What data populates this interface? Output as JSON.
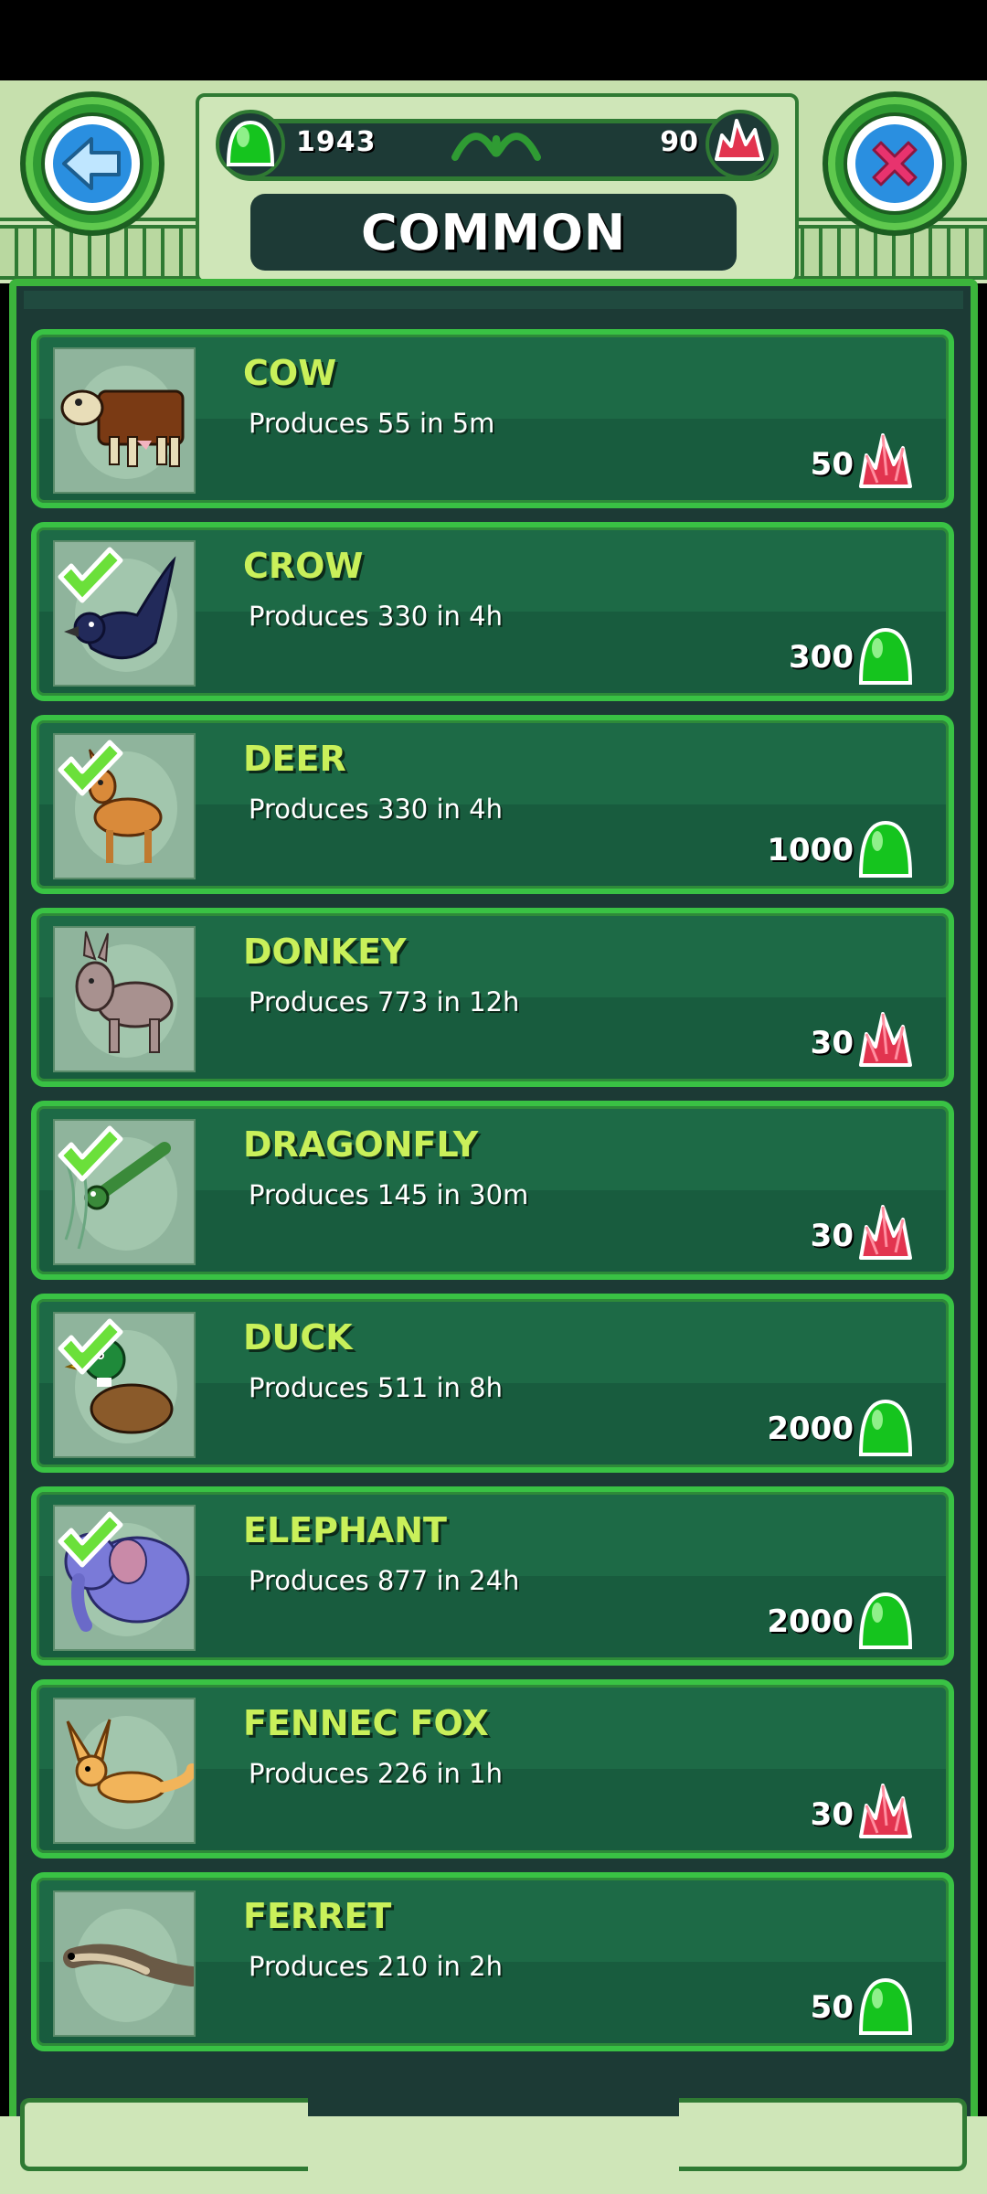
{
  "header": {
    "gem_count": "1943",
    "ruby_count": "90",
    "title": "COMMON",
    "back_icon": "back-arrow-icon",
    "close_icon": "close-x-icon"
  },
  "colors": {
    "row_border": "#39c244",
    "name_text": "#c9f05a",
    "panel_bg": "#1c3a35"
  },
  "animals": [
    {
      "name": "COW",
      "desc": "Produces 55 in 5m",
      "price": "50",
      "currency": "ruby",
      "owned": false,
      "icon": "cow-icon"
    },
    {
      "name": "CROW",
      "desc": "Produces 330 in 4h",
      "price": "300",
      "currency": "gem",
      "owned": true,
      "icon": "crow-icon"
    },
    {
      "name": "DEER",
      "desc": "Produces 330 in 4h",
      "price": "1000",
      "currency": "gem",
      "owned": true,
      "icon": "deer-icon"
    },
    {
      "name": "DONKEY",
      "desc": "Produces 773 in 12h",
      "price": "30",
      "currency": "ruby",
      "owned": false,
      "icon": "donkey-icon"
    },
    {
      "name": "DRAGONFLY",
      "desc": "Produces 145 in 30m",
      "price": "30",
      "currency": "ruby",
      "owned": true,
      "icon": "dragonfly-icon"
    },
    {
      "name": "DUCK",
      "desc": "Produces 511 in 8h",
      "price": "2000",
      "currency": "gem",
      "owned": true,
      "icon": "duck-icon"
    },
    {
      "name": "ELEPHANT",
      "desc": "Produces 877 in 24h",
      "price": "2000",
      "currency": "gem",
      "owned": true,
      "icon": "elephant-icon"
    },
    {
      "name": "FENNEC FOX",
      "desc": "Produces 226 in 1h",
      "price": "30",
      "currency": "ruby",
      "owned": false,
      "icon": "fennec-fox-icon"
    },
    {
      "name": "FERRET",
      "desc": "Produces 210 in 2h",
      "price": "50",
      "currency": "gem",
      "owned": false,
      "icon": "ferret-icon"
    }
  ]
}
